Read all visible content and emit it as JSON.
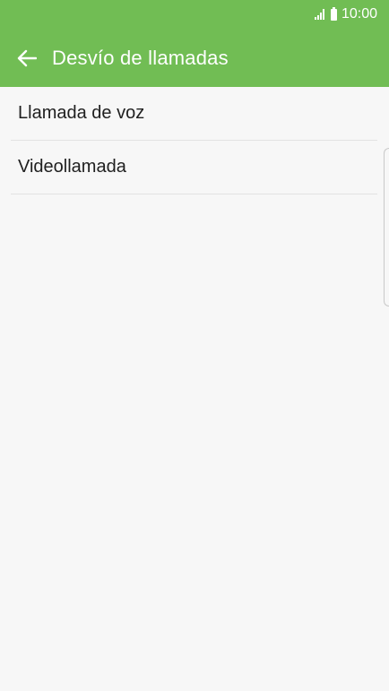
{
  "status_bar": {
    "time": "10:00",
    "icons": [
      "signal-icon",
      "battery-icon"
    ]
  },
  "app_bar": {
    "back_icon": "arrow-left-icon",
    "title": "Desvío de llamadas",
    "background_color": "#71bd54",
    "text_color": "#ffffff"
  },
  "list": {
    "items": [
      {
        "label": "Llamada de voz"
      },
      {
        "label": "Videollamada"
      }
    ]
  }
}
